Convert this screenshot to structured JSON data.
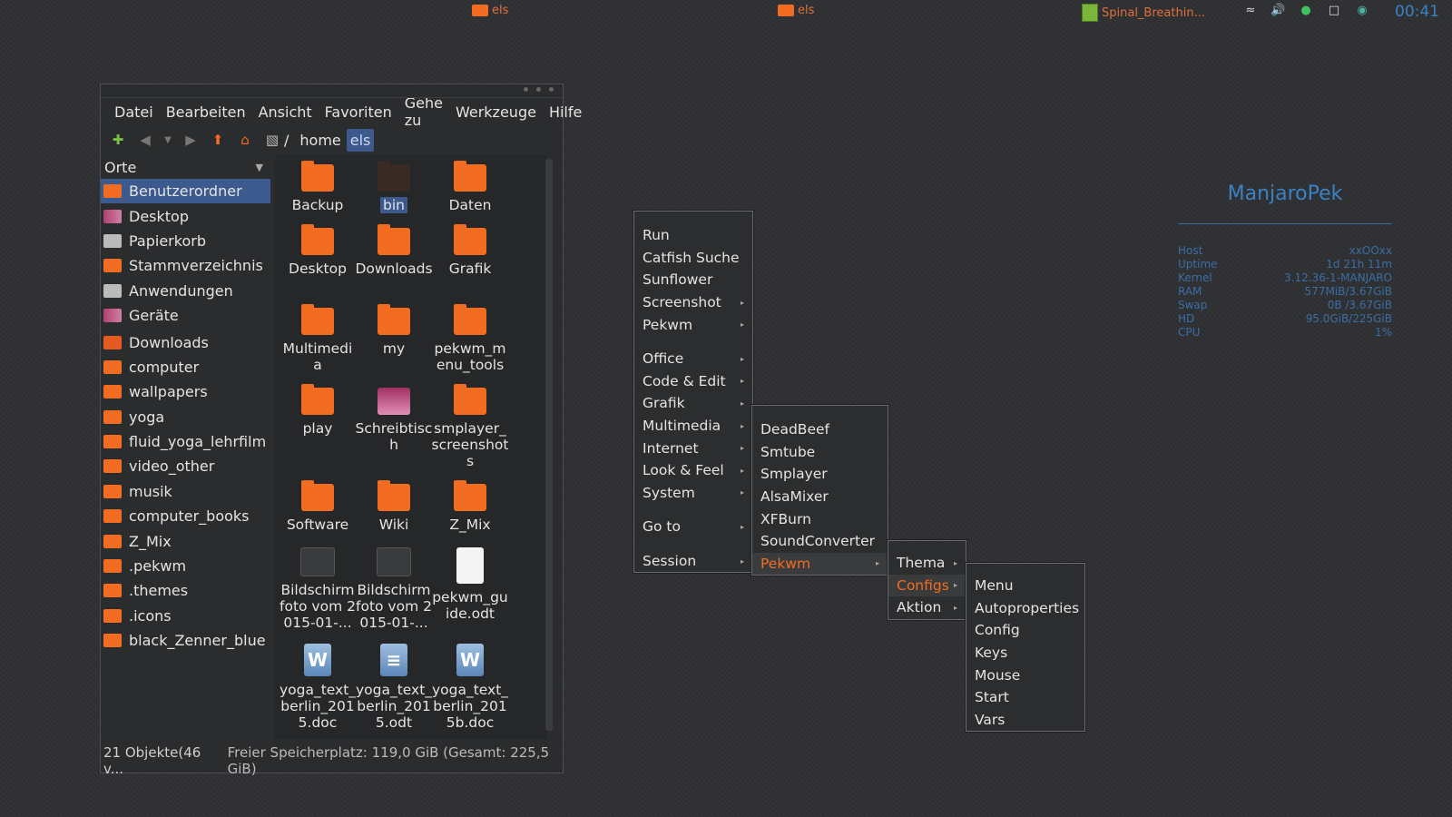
{
  "topbar": {
    "tasks": [
      {
        "label": "els"
      },
      {
        "label": "els"
      },
      {
        "label": "Spinal_Breathin..."
      }
    ],
    "tray_icons": [
      "wifi-icon",
      "volume-icon",
      "ghost-icon",
      "clipboard-icon",
      "network-icon"
    ],
    "clock": "00:41"
  },
  "filemanager": {
    "menubar": [
      "Datei",
      "Bearbeiten",
      "Ansicht",
      "Favoriten",
      "Gehe zu",
      "Werkzeuge",
      "Hilfe"
    ],
    "path": {
      "root": "/",
      "crumbs": [
        "home",
        "els"
      ]
    },
    "sidebar": {
      "header": "Orte",
      "items": [
        {
          "label": "Benutzerordner",
          "icon": "home-folder-icon",
          "selected": true
        },
        {
          "label": "Desktop",
          "icon": "desktop-icon"
        },
        {
          "label": "Papierkorb",
          "icon": "trash-icon"
        },
        {
          "label": "Stammverzeichnis",
          "icon": "folder-icon"
        },
        {
          "label": "Anwendungen",
          "icon": "applications-icon"
        },
        {
          "label": "Geräte",
          "icon": "devices-icon"
        },
        {
          "label": "Downloads",
          "icon": "downloads-folder-icon"
        },
        {
          "label": "computer",
          "icon": "folder-icon"
        },
        {
          "label": "wallpapers",
          "icon": "folder-icon"
        },
        {
          "label": "yoga",
          "icon": "folder-icon"
        },
        {
          "label": "fluid_yoga_lehrfilm",
          "icon": "folder-icon"
        },
        {
          "label": "video_other",
          "icon": "folder-icon"
        },
        {
          "label": "musik",
          "icon": "folder-icon"
        },
        {
          "label": "computer_books",
          "icon": "folder-icon"
        },
        {
          "label": "Z_Mix",
          "icon": "folder-icon"
        },
        {
          "label": ".pekwm",
          "icon": "folder-icon"
        },
        {
          "label": ".themes",
          "icon": "folder-icon"
        },
        {
          "label": ".icons",
          "icon": "folder-icon"
        },
        {
          "label": "black_Zenner_blue",
          "icon": "folder-icon"
        }
      ]
    },
    "files": [
      {
        "label": "Backup",
        "icon": "folder-icon"
      },
      {
        "label": "bin",
        "icon": "folder-dark-icon",
        "selected": true
      },
      {
        "label": "Daten",
        "icon": "folder-icon"
      },
      {
        "label": "Desktop",
        "icon": "folder-icon"
      },
      {
        "label": "Downloads",
        "icon": "downloads-folder-icon"
      },
      {
        "label": "Grafik",
        "icon": "folder-icon"
      },
      {
        "label": "Multimedia",
        "icon": "folder-icon"
      },
      {
        "label": "my",
        "icon": "folder-icon"
      },
      {
        "label": "pekwm_menu_tools",
        "icon": "folder-icon"
      },
      {
        "label": "play",
        "icon": "folder-icon"
      },
      {
        "label": "Schreibtisch",
        "icon": "desktop-icon"
      },
      {
        "label": "smplayer_screenshots",
        "icon": "folder-icon"
      },
      {
        "label": "Software",
        "icon": "folder-icon"
      },
      {
        "label": "Wiki",
        "icon": "folder-icon"
      },
      {
        "label": "Z_Mix",
        "icon": "folder-icon"
      },
      {
        "label": "Bildschirmfoto vom 2015-01-...",
        "icon": "screenshot-thumbnail-icon"
      },
      {
        "label": "Bildschirmfoto vom 2015-01-...",
        "icon": "screenshot-thumbnail-icon"
      },
      {
        "label": "pekwm_guide.odt",
        "icon": "document-icon"
      },
      {
        "label": "yoga_text_berlin_2015.doc",
        "icon": "word-document-icon"
      },
      {
        "label": "yoga_text_berlin_2015.odt",
        "icon": "writer-document-icon"
      },
      {
        "label": "yoga_text_berlin_2015b.doc",
        "icon": "word-document-icon"
      }
    ],
    "statusbar": {
      "count": "21 Objekte(46 v...",
      "free": "Freier Speicherplatz: 119,0 GiB (Gesamt: 225,5 GiB)"
    }
  },
  "menus": {
    "root": {
      "items": [
        {
          "label": "Run"
        },
        {
          "label": "Catfish Suche"
        },
        {
          "label": "Sunflower"
        },
        {
          "label": "Screenshot",
          "submenu": true
        },
        {
          "label": "Pekwm",
          "submenu": true
        },
        {
          "gap": true
        },
        {
          "label": "Office",
          "submenu": true
        },
        {
          "label": "Code & Edit",
          "submenu": true
        },
        {
          "label": "Grafik",
          "submenu": true
        },
        {
          "label": "Multimedia",
          "submenu": true
        },
        {
          "label": "Internet",
          "submenu": true
        },
        {
          "label": "Look & Feel",
          "submenu": true
        },
        {
          "label": "System",
          "submenu": true
        },
        {
          "gap": true
        },
        {
          "label": "Go to",
          "submenu": true
        },
        {
          "gap": true
        },
        {
          "label": "Session",
          "submenu": true
        }
      ]
    },
    "multimedia": {
      "items": [
        {
          "label": "DeadBeef"
        },
        {
          "label": "Smtube"
        },
        {
          "label": "Smplayer"
        },
        {
          "label": "AlsaMixer"
        },
        {
          "label": "XFBurn"
        },
        {
          "label": "SoundConverter"
        },
        {
          "label": "Pekwm",
          "submenu": true,
          "active": true
        }
      ]
    },
    "pekwm": {
      "items": [
        {
          "label": "Thema",
          "submenu": true
        },
        {
          "label": "Configs",
          "submenu": true,
          "active": true
        },
        {
          "label": "Aktion",
          "submenu": true
        }
      ]
    },
    "configs": {
      "items": [
        {
          "label": "Menu"
        },
        {
          "label": "Autoproperties"
        },
        {
          "label": "Config"
        },
        {
          "label": "Keys"
        },
        {
          "label": "Mouse"
        },
        {
          "label": "Start"
        },
        {
          "label": "Vars"
        }
      ]
    }
  },
  "conky": {
    "title": "ManjaroPek",
    "rows": [
      {
        "key": "Host",
        "value": "xxOOxx"
      },
      {
        "key": "Uptime",
        "value": "1d 21h 11m"
      },
      {
        "key": "Kernel",
        "value": "3.12.36-1-MANJARO"
      },
      {
        "key": "RAM",
        "value": "577MiB/3.67GiB"
      },
      {
        "key": "Swap",
        "value": "0B  /3.67GiB"
      },
      {
        "key": "HD",
        "value": "95.0GiB/225GiB"
      },
      {
        "key": "CPU",
        "value": "1%"
      }
    ]
  },
  "colors": {
    "accent": "#f26d21",
    "selection": "#3c5a8e",
    "conky": "#3b82c4"
  }
}
